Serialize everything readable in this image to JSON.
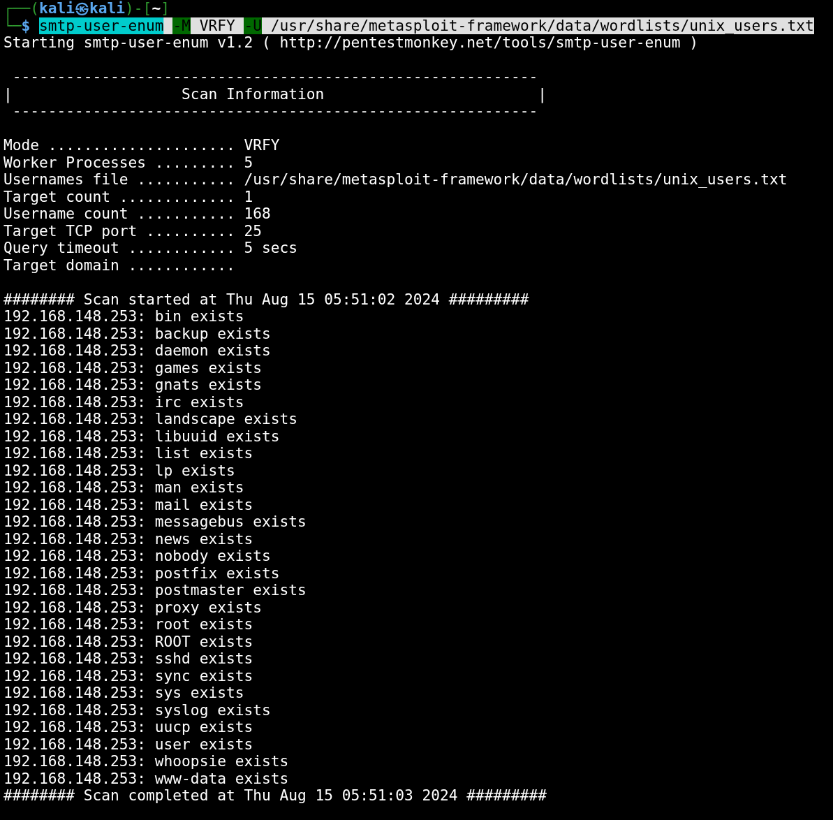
{
  "prompt": {
    "lines": [
      [
        {
          "text": "┌──(",
          "kind": "frame"
        },
        {
          "text": "kali㉿kali",
          "kind": "user"
        },
        {
          "text": ")-[",
          "kind": "frame"
        },
        {
          "text": "~",
          "kind": "cwd"
        },
        {
          "text": "]",
          "kind": "frame"
        }
      ],
      [
        {
          "text": "└─",
          "kind": "frame"
        },
        {
          "text": "$",
          "kind": "symbol"
        },
        {
          "text": "smtp-user-enum",
          "kind": "command"
        },
        {
          "text": "-M",
          "kind": "flag"
        },
        {
          "text": " VRFY ",
          "kind": "argument"
        },
        {
          "text": "-U",
          "kind": "flag"
        },
        {
          "text": " /usr/share/metasploit-framework/data/wordlists/unix_users.txt",
          "kind": "argument"
        }
      ]
    ]
  },
  "banner": "Starting smtp-user-enum v1.2 ( http://pentestmonkey.net/tools/smtp-user-enum )",
  "scan_information_box": [
    " -----------------------------------------------------------",
    "|                   Scan Information                        |",
    " -----------------------------------------------------------"
  ],
  "settings": [
    {
      "label": "Mode .....................",
      "value": "VRFY"
    },
    {
      "label": "Worker Processes .........",
      "value": "5"
    },
    {
      "label": "Usernames file ...........",
      "value": "/usr/share/metasploit-framework/data/wordlists/unix_users.txt"
    },
    {
      "label": "Target count .............",
      "value": "1"
    },
    {
      "label": "Username count ...........",
      "value": "168"
    },
    {
      "label": "Target TCP port ..........",
      "value": "25"
    },
    {
      "label": "Query timeout ............",
      "value": "5 secs"
    },
    {
      "label": "Target domain ............"
    }
  ],
  "scan_started": "######## Scan started at Thu Aug 15 05:51:02 2024 #########",
  "results": [
    "192.168.148.253: bin exists",
    "192.168.148.253: backup exists",
    "192.168.148.253: daemon exists",
    "192.168.148.253: games exists",
    "192.168.148.253: gnats exists",
    "192.168.148.253: irc exists",
    "192.168.148.253: landscape exists",
    "192.168.148.253: libuuid exists",
    "192.168.148.253: list exists",
    "192.168.148.253: lp exists",
    "192.168.148.253: man exists",
    "192.168.148.253: mail exists",
    "192.168.148.253: messagebus exists",
    "192.168.148.253: news exists",
    "192.168.148.253: nobody exists",
    "192.168.148.253: postfix exists",
    "192.168.148.253: postmaster exists",
    "192.168.148.253: proxy exists",
    "192.168.148.253: root exists",
    "192.168.148.253: ROOT exists",
    "192.168.148.253: sshd exists",
    "192.168.148.253: sync exists",
    "192.168.148.253: sys exists",
    "192.168.148.253: syslog exists",
    "192.168.148.253: uucp exists",
    "192.168.148.253: user exists",
    "192.168.148.253: whoopsie exists",
    "192.168.148.253: www-data exists"
  ],
  "scan_completed": "######## Scan completed at Thu Aug 15 05:51:03 2024 #########"
}
